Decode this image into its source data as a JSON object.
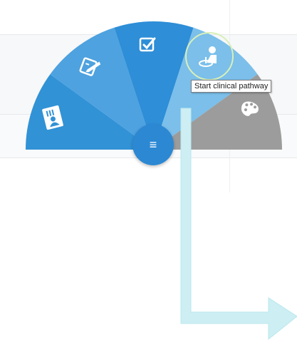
{
  "tooltip": {
    "text": "Start clinical pathway"
  },
  "menu_button": {
    "glyph": "≡"
  },
  "wheel": {
    "segments": [
      {
        "name": "patient-card",
        "icon": "patient-card-icon",
        "color": "#3192d6"
      },
      {
        "name": "edit-note",
        "icon": "edit-note-icon",
        "color": "#4fa4e1"
      },
      {
        "name": "checklist",
        "icon": "checkbox-icon",
        "color": "#2f8fd8"
      },
      {
        "name": "clinical-pathway",
        "icon": "doctor-icon",
        "color": "#79bde9",
        "active": true
      },
      {
        "name": "palette",
        "icon": "palette-icon",
        "color": "#9b9b9b"
      }
    ]
  },
  "colors": {
    "arrow": "#b9e8ee",
    "arrow_fill": "#cdeef3",
    "highlight_ring": "#d9efb8"
  }
}
